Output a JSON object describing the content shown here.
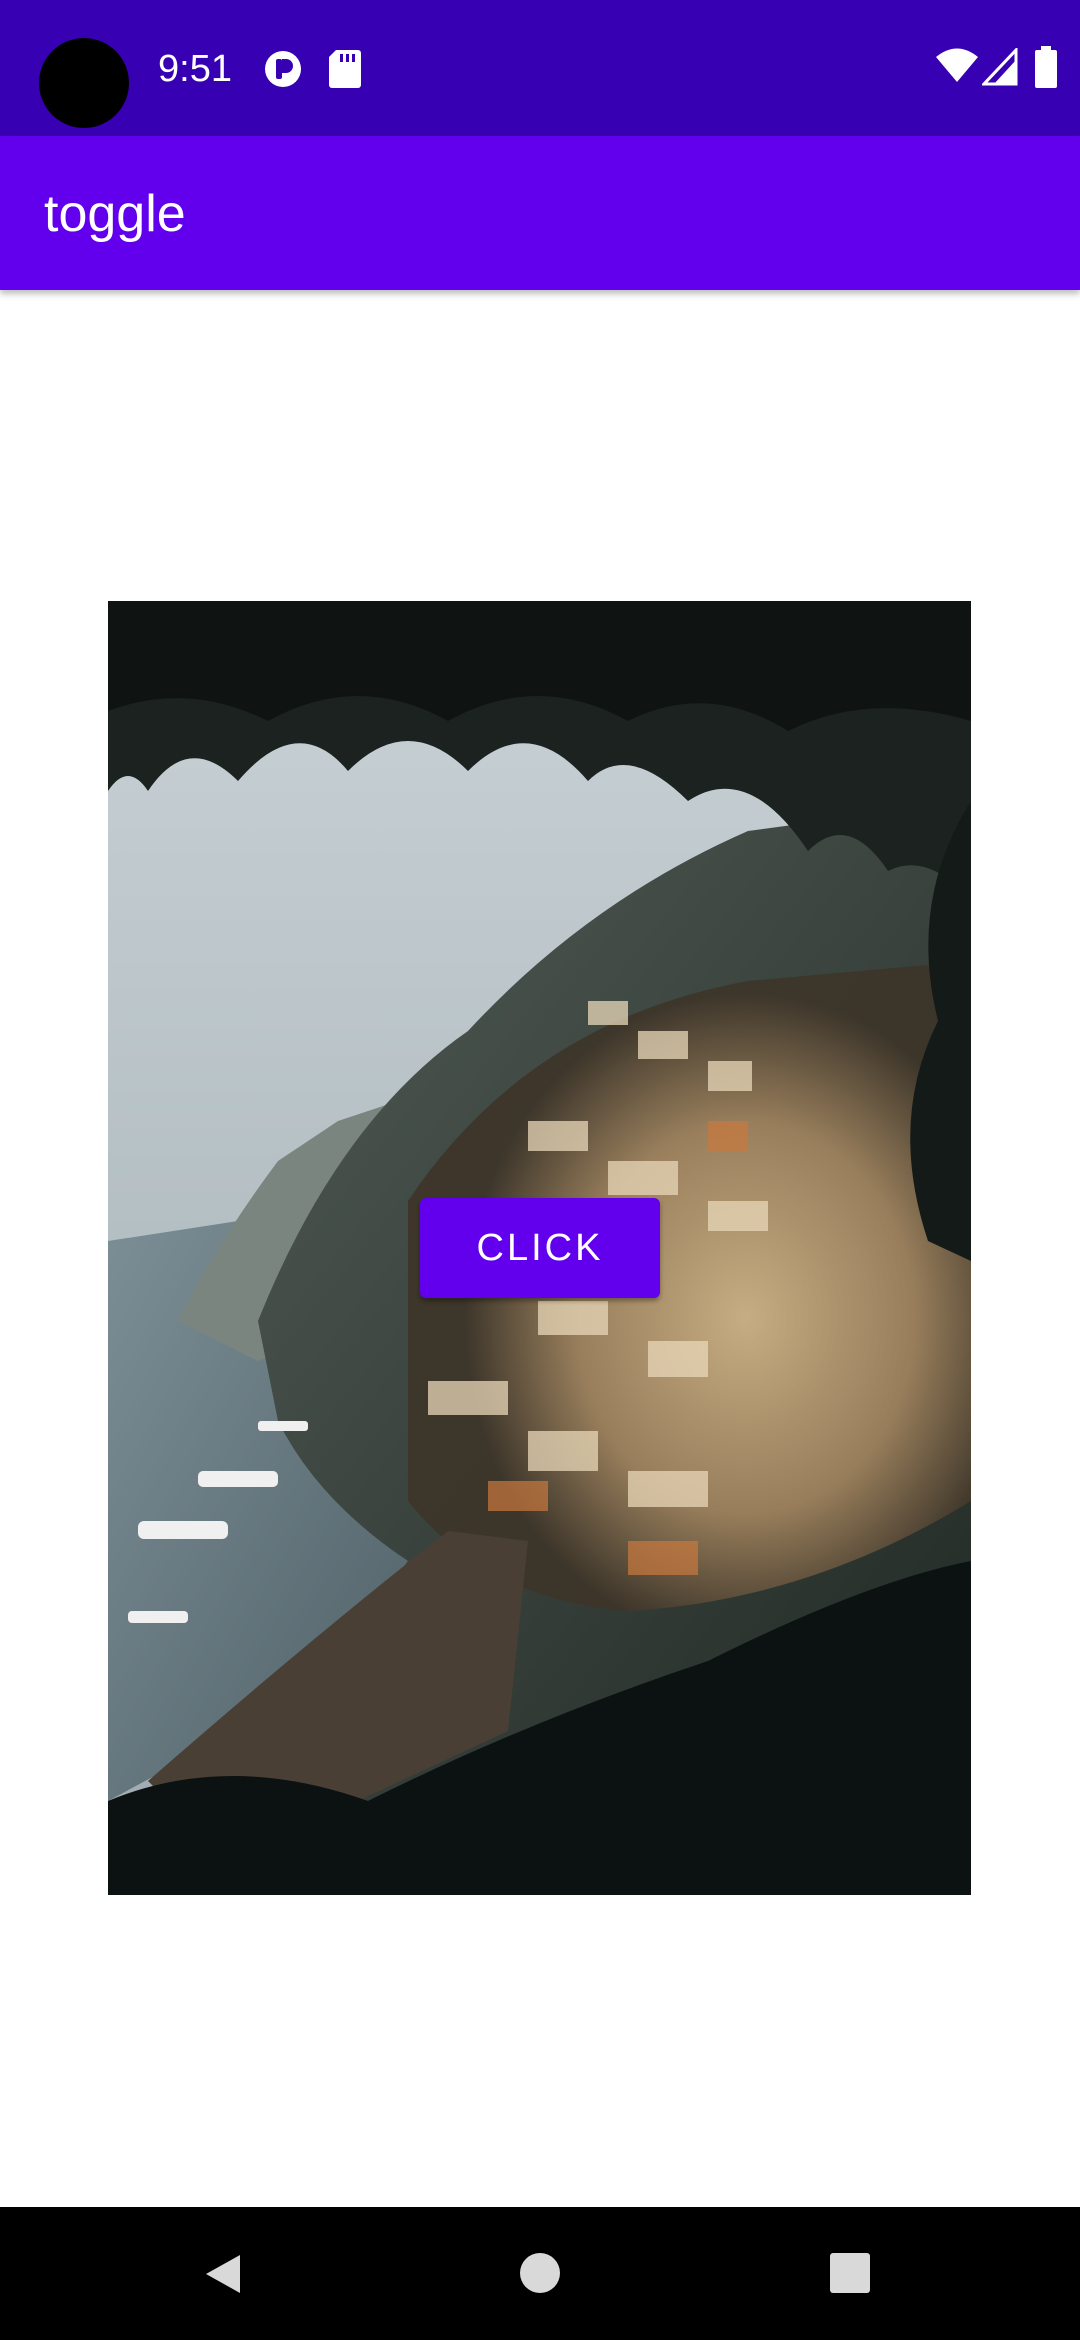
{
  "status_bar": {
    "time": "9:51",
    "icons": [
      "camera-cutout",
      "notification-icon",
      "sd-card-icon",
      "wifi-icon",
      "signal-icon",
      "battery-icon"
    ],
    "background": "#3700B3"
  },
  "app_bar": {
    "title": "toggle",
    "background": "#6200EE"
  },
  "main": {
    "image": {
      "subject": "Coastal cliffside village with beach and boats, framed by overhanging foliage"
    },
    "button": {
      "label": "CLICK",
      "color": "#6200EE"
    }
  },
  "nav_bar": {
    "buttons": [
      "back-icon",
      "home-icon",
      "recents-icon"
    ],
    "background": "#000000"
  }
}
